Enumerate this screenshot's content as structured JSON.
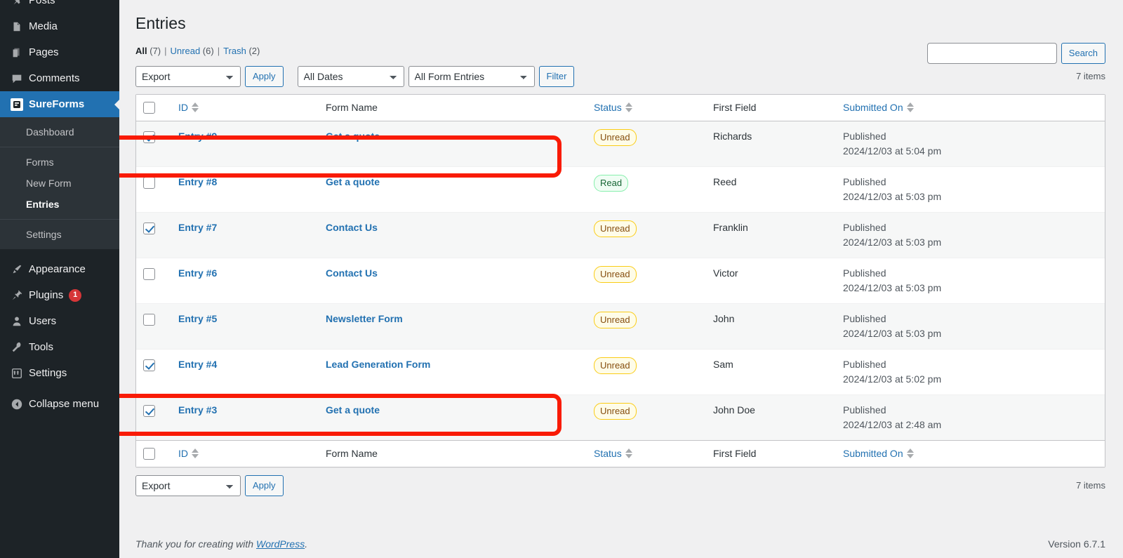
{
  "sidebar": {
    "items": [
      {
        "label": "Posts",
        "icon": "pin-icon",
        "current": false
      },
      {
        "label": "Media",
        "icon": "media-icon",
        "current": false
      },
      {
        "label": "Pages",
        "icon": "pages-icon",
        "current": false
      },
      {
        "label": "Comments",
        "icon": "comments-icon",
        "current": false
      },
      {
        "label": "SureForms",
        "icon": "sureforms-icon",
        "current": true
      }
    ],
    "sureforms_submenu": [
      {
        "label": "Dashboard",
        "current": false
      },
      {
        "label": "Forms",
        "current": false
      },
      {
        "label": "New Form",
        "current": false
      },
      {
        "label": "Entries",
        "current": true
      },
      {
        "label": "Settings",
        "current": false
      }
    ],
    "lower_items": [
      {
        "label": "Appearance",
        "icon": "appearance-icon",
        "badge": ""
      },
      {
        "label": "Plugins",
        "icon": "plugins-icon",
        "badge": "1"
      },
      {
        "label": "Users",
        "icon": "users-icon",
        "badge": ""
      },
      {
        "label": "Tools",
        "icon": "tools-icon",
        "badge": ""
      },
      {
        "label": "Settings",
        "icon": "settings-icon",
        "badge": ""
      }
    ],
    "collapse_label": "Collapse menu"
  },
  "page": {
    "title": "Entries"
  },
  "filters": {
    "all_label": "All",
    "all_count": "(7)",
    "unread_label": "Unread",
    "unread_count": "(6)",
    "trash_label": "Trash",
    "trash_count": "(2)",
    "divider": "|"
  },
  "search": {
    "value": "",
    "placeholder": "",
    "button_label": "Search"
  },
  "tablenav_top": {
    "bulk_action": "Export",
    "apply_label": "Apply",
    "date_filter": "All Dates",
    "form_filter": "All Form Entries",
    "filter_label": "Filter",
    "displaying_num": "7 items"
  },
  "tablenav_bottom": {
    "bulk_action": "Export",
    "apply_label": "Apply",
    "displaying_num": "7 items"
  },
  "table": {
    "columns": {
      "id": "ID",
      "form_name": "Form Name",
      "status": "Status",
      "first_field": "First Field",
      "submitted_on": "Submitted On"
    },
    "rows": [
      {
        "id": "Entry #9",
        "form_name": "Get a quote",
        "status": "Unread",
        "status_type": "unread",
        "first_field": "Richards",
        "publish_state": "Published",
        "date": "2024/12/03 at 5:04 pm",
        "checked": true,
        "highlighted": true
      },
      {
        "id": "Entry #8",
        "form_name": "Get a quote",
        "status": "Read",
        "status_type": "read",
        "first_field": "Reed",
        "publish_state": "Published",
        "date": "2024/12/03 at 5:03 pm",
        "checked": false,
        "highlighted": false
      },
      {
        "id": "Entry #7",
        "form_name": "Contact Us",
        "status": "Unread",
        "status_type": "unread",
        "first_field": "Franklin",
        "publish_state": "Published",
        "date": "2024/12/03 at 5:03 pm",
        "checked": true,
        "highlighted": false
      },
      {
        "id": "Entry #6",
        "form_name": "Contact Us",
        "status": "Unread",
        "status_type": "unread",
        "first_field": "Victor",
        "publish_state": "Published",
        "date": "2024/12/03 at 5:03 pm",
        "checked": false,
        "highlighted": false
      },
      {
        "id": "Entry #5",
        "form_name": "Newsletter Form",
        "status": "Unread",
        "status_type": "unread",
        "first_field": "John",
        "publish_state": "Published",
        "date": "2024/12/03 at 5:03 pm",
        "checked": false,
        "highlighted": false
      },
      {
        "id": "Entry #4",
        "form_name": "Lead Generation Form",
        "status": "Unread",
        "status_type": "unread",
        "first_field": "Sam",
        "publish_state": "Published",
        "date": "2024/12/03 at 5:02 pm",
        "checked": true,
        "highlighted": false
      },
      {
        "id": "Entry #3",
        "form_name": "Get a quote",
        "status": "Unread",
        "status_type": "unread",
        "first_field": "John Doe",
        "publish_state": "Published",
        "date": "2024/12/03 at 2:48 am",
        "checked": true,
        "highlighted": true
      }
    ]
  },
  "footer": {
    "thanks_prefix": "Thank you for creating with ",
    "wordpress_link": "WordPress",
    "thanks_suffix": ".",
    "version": "Version 6.7.1"
  },
  "colors": {
    "accent_blue": "#2271b1",
    "sidebar_bg": "#1d2327",
    "submenu_bg": "#2c3338",
    "badge_red": "#d63638",
    "highlight_red": "#f91b06",
    "unread_border": "#facc15",
    "unread_text": "#854d0e",
    "read_border": "#86efac",
    "read_text": "#166534"
  }
}
